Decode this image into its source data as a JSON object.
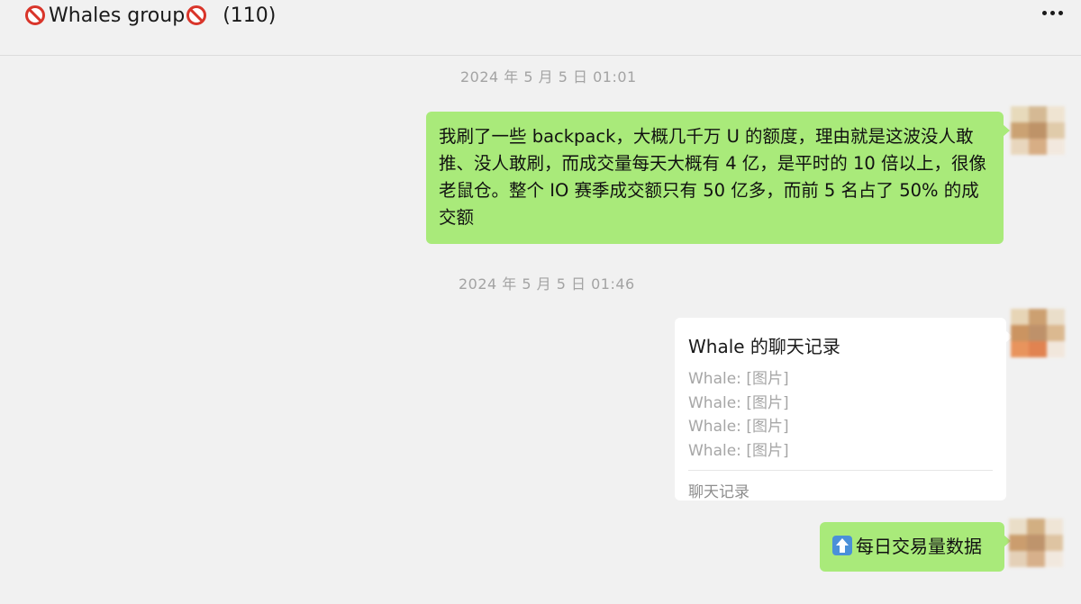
{
  "header": {
    "title": "Whales group",
    "member_count": "(110)",
    "title_icon": "no-entry-emoji",
    "more_icon": "more-dots-icon"
  },
  "messages": [
    {
      "timestamp": "2024 年 5 月 5 日 01:01",
      "type": "text",
      "text": "我刷了一些 backpack，大概几千万 U 的额度，理由就是这波没人敢推、没人敢刷，而成交量每天大概有 4 亿，是平时的 10 倍以上，很像老鼠仓。整个 IO 赛季成交额只有 50 亿多，而前 5 名占了 50% 的成交额"
    },
    {
      "timestamp": "2024 年 5 月 5 日 01:46",
      "type": "chat-record",
      "card": {
        "title": "Whale 的聊天记录",
        "lines": [
          "Whale: [图片]",
          "Whale: [图片]",
          "Whale: [图片]",
          "Whale: [图片]"
        ],
        "footer": "聊天记录"
      }
    },
    {
      "type": "text",
      "icon": "up-arrow-emoji",
      "text": "每日交易量数据"
    }
  ],
  "colors": {
    "background": "#f1f1f1",
    "own_bubble": "#a9ea7a",
    "timestamp": "#a3a3a3",
    "card": "#ffffff"
  }
}
